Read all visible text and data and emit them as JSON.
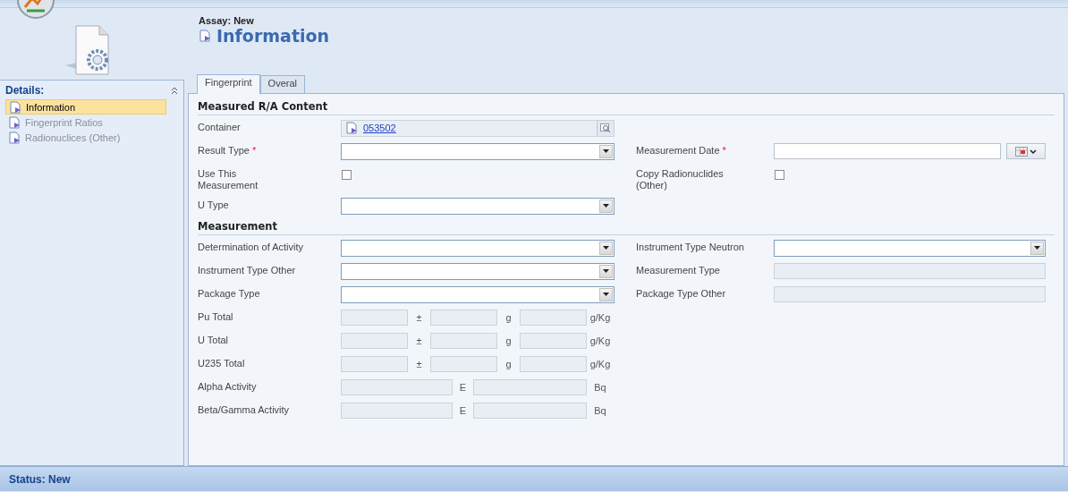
{
  "header": {
    "entity": "Assay: New",
    "title": "Information"
  },
  "sidebar": {
    "heading": "Details:",
    "items": [
      {
        "label": "Information",
        "selected": true
      },
      {
        "label": "Fingerprint Ratios",
        "selected": false
      },
      {
        "label": "Radionuclices (Other)",
        "selected": false
      }
    ]
  },
  "tabs": [
    {
      "label": "Fingerprint",
      "selected": true
    },
    {
      "label": "Overal",
      "selected": false
    }
  ],
  "sections": [
    {
      "title": "Measured R/A Content",
      "rows": [
        {
          "left": {
            "kind": "lookup",
            "label": "Container",
            "value": "053502"
          }
        },
        {
          "left": {
            "kind": "select",
            "label": "Result Type",
            "required_mark": "*"
          },
          "right": {
            "kind": "date",
            "label": "Measurement Date",
            "required_mark": "*"
          }
        },
        {
          "left": {
            "kind": "checkbox",
            "label": "Use This Measurement",
            "checked": false
          },
          "right": {
            "kind": "checkbox",
            "label": "Copy Radionuclides (Other)",
            "checked": false
          }
        },
        {
          "left": {
            "kind": "select",
            "label": "U Type"
          }
        }
      ]
    },
    {
      "title": "Measurement",
      "rows": [
        {
          "left": {
            "kind": "select",
            "label": "Determination of Activity"
          },
          "right": {
            "kind": "select",
            "label": "Instrument Type Neutron"
          }
        },
        {
          "left": {
            "kind": "select",
            "label": "Instrument Type Other"
          },
          "right": {
            "kind": "text",
            "label": "Measurement Type"
          }
        },
        {
          "left": {
            "kind": "select",
            "label": "Package Type"
          },
          "right": {
            "kind": "text",
            "label": "Package Type Other"
          }
        },
        {
          "left": {
            "kind": "triple",
            "label": "Pu Total",
            "sep": "±",
            "unit": "g",
            "unit2": "g/Kg"
          }
        },
        {
          "left": {
            "kind": "triple",
            "label": "U Total",
            "sep": "±",
            "unit": "g",
            "unit2": "g/Kg"
          }
        },
        {
          "left": {
            "kind": "triple",
            "label": "U235 Total",
            "sep": "±",
            "unit": "g",
            "unit2": "g/Kg"
          }
        },
        {
          "left": {
            "kind": "pair",
            "label": "Alpha Activity",
            "sep": "E",
            "unit": "Bq"
          }
        },
        {
          "left": {
            "kind": "pair",
            "label": "Beta/Gamma Activity",
            "sep": "E",
            "unit": "Bq"
          }
        }
      ]
    }
  ],
  "status_bar": {
    "text": "Status: New"
  }
}
